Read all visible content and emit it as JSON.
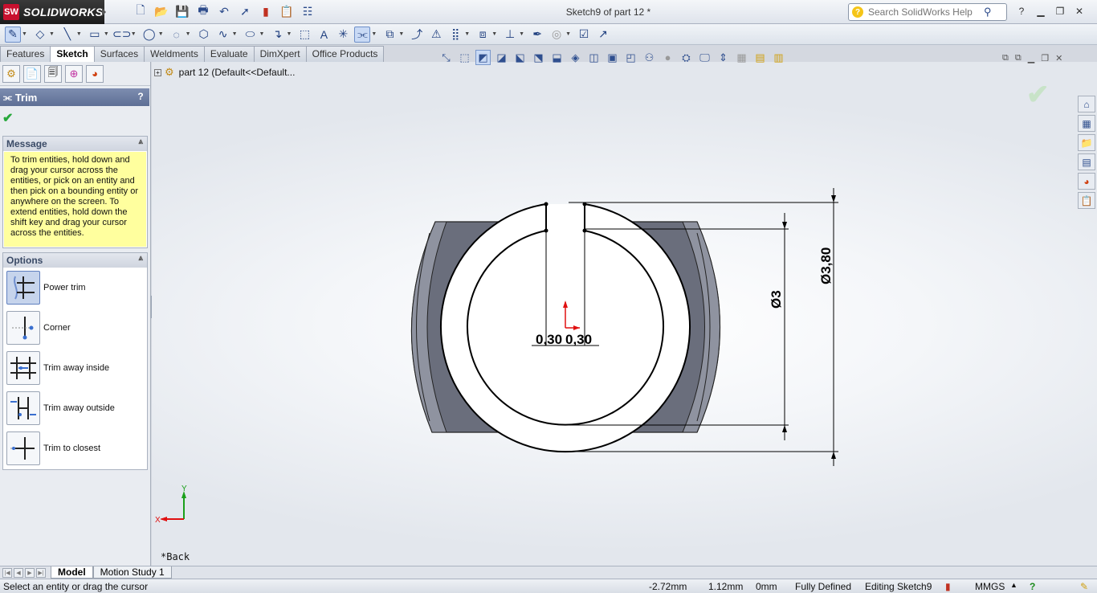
{
  "app": {
    "brand": "SOLIDWORKS",
    "brand_mark": "SW",
    "doc_title": "Sketch9 of part 12 *"
  },
  "search": {
    "placeholder": "Search SolidWorks Help"
  },
  "tabs": [
    {
      "label": "Features"
    },
    {
      "label": "Sketch",
      "active": true
    },
    {
      "label": "Surfaces"
    },
    {
      "label": "Weldments"
    },
    {
      "label": "Evaluate"
    },
    {
      "label": "DimXpert"
    },
    {
      "label": "Office Products"
    }
  ],
  "property_manager": {
    "title": "Trim",
    "help": "?",
    "message_title": "Message",
    "message_lines": [
      "To trim entities, hold down and",
      "drag your cursor across the",
      "entities, or pick on an entity and",
      "then pick on a bounding entity or",
      "anywhere on the screen.  To",
      "extend entities, hold down the",
      "shift key and drag your cursor",
      "across the entities."
    ],
    "options_title": "Options",
    "options": [
      {
        "label": "Power trim",
        "selected": true
      },
      {
        "label": "Corner"
      },
      {
        "label": "Trim away inside"
      },
      {
        "label": "Trim away outside"
      },
      {
        "label": "Trim to closest"
      }
    ]
  },
  "tree": {
    "root": "part 12  (Default<<Default..."
  },
  "drawing": {
    "dim_outer": "Ø3,80",
    "dim_inner": "Ø3",
    "dim_gap_left": "0,30",
    "dim_gap_right": "0,30",
    "axis_x": "X",
    "axis_y": "Y",
    "view_label": "*Back",
    "dim_color": "#000000",
    "origin_color": "#e01010",
    "solid_color": "#6a6e7c"
  },
  "bottom_tabs": [
    {
      "label": "Model",
      "active": true
    },
    {
      "label": "Motion Study 1"
    }
  ],
  "status": {
    "prompt": "Select an entity or drag the cursor",
    "x": "-2.72mm",
    "y": "1.12mm",
    "z": "0mm",
    "state": "Fully Defined",
    "editing": "Editing Sketch9",
    "units": "MMGS"
  }
}
